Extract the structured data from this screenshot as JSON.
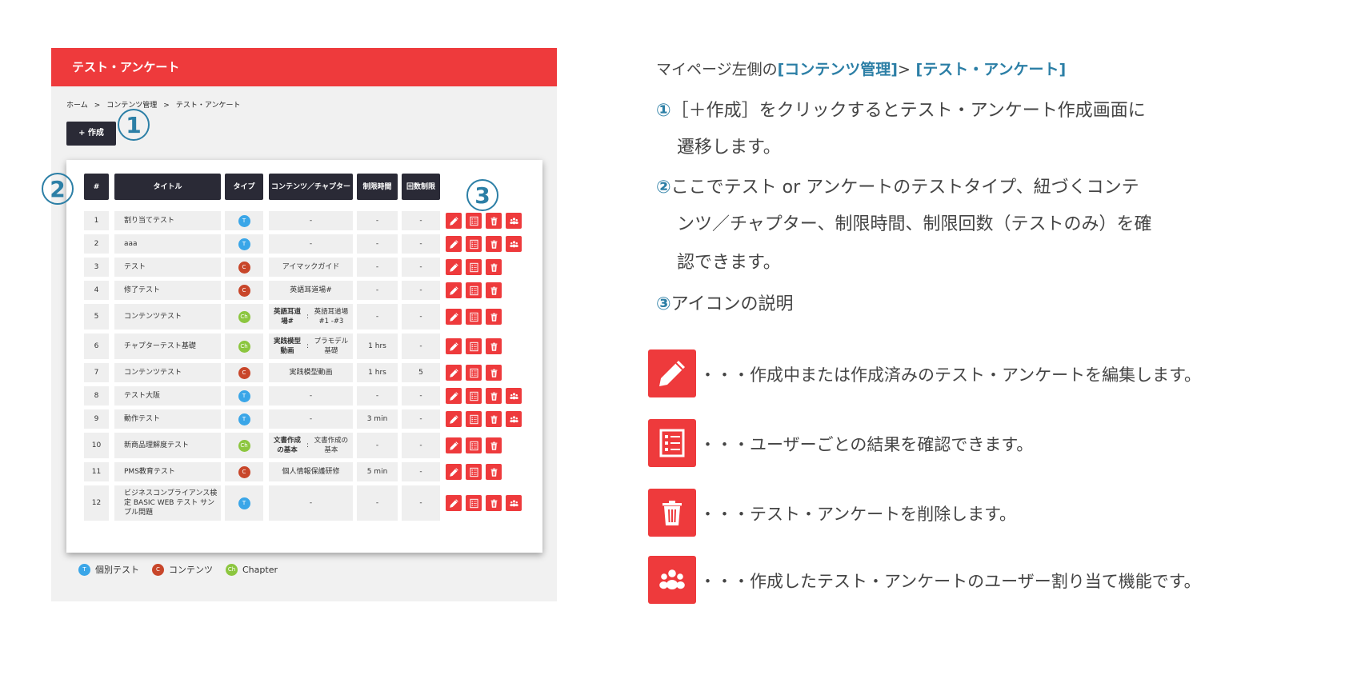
{
  "app": {
    "title": "テスト・アンケート",
    "breadcrumb": [
      "ホーム",
      "コンテンツ管理",
      "テスト・アンケート"
    ],
    "breadcrumb_sep": ">",
    "create_button": "+ 作成",
    "callouts": [
      "1",
      "2",
      "3"
    ],
    "columns": [
      "#",
      "タイトル",
      "タイプ",
      "コンテンツ／チャプター",
      "制限時間",
      "回数制限"
    ],
    "rows": [
      {
        "no": "1",
        "title": "割り当てテスト",
        "type": "T",
        "content": "-",
        "time": "-",
        "count": "-",
        "assign": true
      },
      {
        "no": "2",
        "title": "aaa",
        "type": "T",
        "content": "-",
        "time": "-",
        "count": "-",
        "assign": true
      },
      {
        "no": "3",
        "title": "テスト",
        "type": "C",
        "content": "アイマックガイド",
        "time": "-",
        "count": "-",
        "assign": false
      },
      {
        "no": "4",
        "title": "修了テスト",
        "type": "C",
        "content": "英語耳道場#",
        "time": "-",
        "count": "-",
        "assign": false
      },
      {
        "no": "5",
        "title": "コンテンツテスト",
        "type": "Ch",
        "content_label": "英語耳道場#",
        "content": "英語耳道場 #1 -#3",
        "time": "-",
        "count": "-",
        "assign": false
      },
      {
        "no": "6",
        "title": "チャプターテスト基礎",
        "type": "Ch",
        "content_label": "実践模型動画",
        "content": "プラモデル基礎",
        "time": "1 hrs",
        "count": "-",
        "assign": false
      },
      {
        "no": "7",
        "title": "コンテンツテスト",
        "type": "C",
        "content": "実践模型動画",
        "time": "1 hrs",
        "count": "5",
        "assign": false
      },
      {
        "no": "8",
        "title": "テスト大阪",
        "type": "T",
        "content": "-",
        "time": "-",
        "count": "-",
        "assign": true
      },
      {
        "no": "9",
        "title": "動作テスト",
        "type": "T",
        "content": "-",
        "time": "3 min",
        "count": "-",
        "assign": true
      },
      {
        "no": "10",
        "title": "新商品理解度テスト",
        "type": "Ch",
        "content_label": "文書作成の基本",
        "content": "文書作成の基本",
        "time": "-",
        "count": "-",
        "assign": false
      },
      {
        "no": "11",
        "title": "PMS教育テスト",
        "type": "C",
        "content": "個人情報保護研修",
        "time": "5 min",
        "count": "-",
        "assign": false
      },
      {
        "no": "12",
        "title": "ビジネスコンプライアンス検定 BASIC WEB テスト サンプル問題",
        "type": "T",
        "content": "-",
        "time": "-",
        "count": "-",
        "assign": true
      }
    ],
    "legend": [
      {
        "type": "T",
        "label": "個別テスト"
      },
      {
        "type": "C",
        "label": "コンテンツ"
      },
      {
        "type": "Ch",
        "label": "Chapter"
      }
    ]
  },
  "colors": {
    "red": "#ee3a3c",
    "dark": "#2a2a36",
    "accent": "#2c7fa6",
    "T": "#3aa6e8",
    "C": "#c8462a",
    "Ch": "#8cc63f"
  },
  "explain": {
    "path_prefix": "マイページ左側の",
    "path_a": "[コンテンツ管理]",
    "path_sep": ">",
    "path_b": " [テスト・アンケート]",
    "step1_num": "①",
    "step1_l1": "［＋作成］をクリックするとテスト・アンケート作成画面に",
    "step1_l2": "遷移します。",
    "step2_num": "②",
    "step2_l1": "ここでテスト or アンケートのテストタイプ、紐づくコンテ",
    "step2_l2": "ンツ／チャプター、制限時間、制限回数（テストのみ）を確",
    "step2_l3": "認できます。",
    "step3_num": "③",
    "step3_l1": "アイコンの説明",
    "icons": [
      {
        "icon": "pencil-icon",
        "text": "・・・作成中または作成済みのテスト・アンケートを編集します。"
      },
      {
        "icon": "list-icon",
        "text": "・・・ユーザーごとの結果を確認できます。"
      },
      {
        "icon": "trash-icon",
        "text": "・・・テスト・アンケートを削除します。"
      },
      {
        "icon": "users-icon",
        "text": "・・・作成したテスト・アンケートのユーザー割り当て機能です。"
      }
    ]
  }
}
